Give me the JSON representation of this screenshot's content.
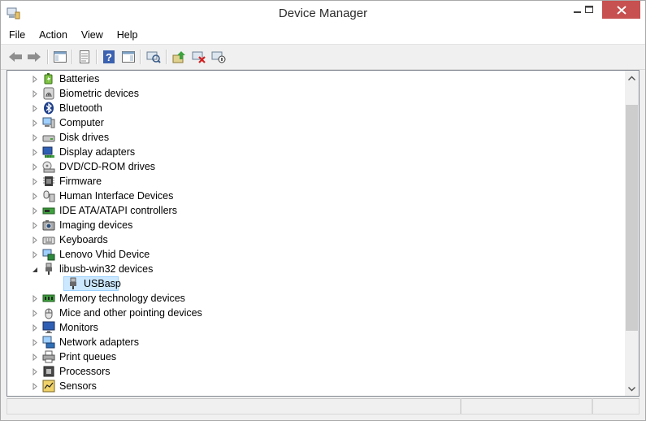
{
  "window": {
    "title": "Device Manager"
  },
  "menu": [
    {
      "label": "File"
    },
    {
      "label": "Action"
    },
    {
      "label": "View"
    },
    {
      "label": "Help"
    }
  ],
  "toolbar": [
    {
      "name": "back-icon"
    },
    {
      "name": "forward-icon"
    },
    {
      "name": "show-hide-console-tree-icon"
    },
    {
      "name": "properties-icon"
    },
    {
      "name": "help-icon"
    },
    {
      "name": "action-pane-icon"
    },
    {
      "name": "scan-hardware-icon"
    },
    {
      "name": "update-driver-icon"
    },
    {
      "name": "uninstall-icon"
    },
    {
      "name": "disable-device-icon"
    }
  ],
  "tree": [
    {
      "label": "Batteries",
      "icon": "battery-icon",
      "expanded": false,
      "level": 0
    },
    {
      "label": "Biometric devices",
      "icon": "fingerprint-icon",
      "expanded": false,
      "level": 0
    },
    {
      "label": "Bluetooth",
      "icon": "bluetooth-icon",
      "expanded": false,
      "level": 0
    },
    {
      "label": "Computer",
      "icon": "computer-icon",
      "expanded": false,
      "level": 0
    },
    {
      "label": "Disk drives",
      "icon": "disk-drive-icon",
      "expanded": false,
      "level": 0
    },
    {
      "label": "Display adapters",
      "icon": "display-adapter-icon",
      "expanded": false,
      "level": 0
    },
    {
      "label": "DVD/CD-ROM drives",
      "icon": "dvd-drive-icon",
      "expanded": false,
      "level": 0
    },
    {
      "label": "Firmware",
      "icon": "firmware-icon",
      "expanded": false,
      "level": 0
    },
    {
      "label": "Human Interface Devices",
      "icon": "hid-icon",
      "expanded": false,
      "level": 0
    },
    {
      "label": "IDE ATA/ATAPI controllers",
      "icon": "ide-controller-icon",
      "expanded": false,
      "level": 0
    },
    {
      "label": "Imaging devices",
      "icon": "camera-icon",
      "expanded": false,
      "level": 0
    },
    {
      "label": "Keyboards",
      "icon": "keyboard-icon",
      "expanded": false,
      "level": 0
    },
    {
      "label": "Lenovo Vhid Device",
      "icon": "network-device-icon",
      "expanded": false,
      "level": 0
    },
    {
      "label": "libusb-win32 devices",
      "icon": "usb-plug-icon",
      "expanded": true,
      "level": 0
    },
    {
      "label": "USBasp",
      "icon": "usb-plug-icon",
      "expanded": null,
      "level": 1,
      "selected": true
    },
    {
      "label": "Memory technology devices",
      "icon": "memory-icon",
      "expanded": false,
      "level": 0
    },
    {
      "label": "Mice and other pointing devices",
      "icon": "mouse-icon",
      "expanded": false,
      "level": 0
    },
    {
      "label": "Monitors",
      "icon": "monitor-icon",
      "expanded": false,
      "level": 0
    },
    {
      "label": "Network adapters",
      "icon": "network-adapter-icon",
      "expanded": false,
      "level": 0
    },
    {
      "label": "Print queues",
      "icon": "printer-icon",
      "expanded": false,
      "level": 0
    },
    {
      "label": "Processors",
      "icon": "processor-icon",
      "expanded": false,
      "level": 0
    },
    {
      "label": "Sensors",
      "icon": "sensor-icon",
      "expanded": false,
      "level": 0
    }
  ],
  "colors": {
    "selection_bg": "#cce8ff",
    "selection_border": "#99d1ff",
    "close_button": "#c75050",
    "tree_border": "#828790"
  }
}
